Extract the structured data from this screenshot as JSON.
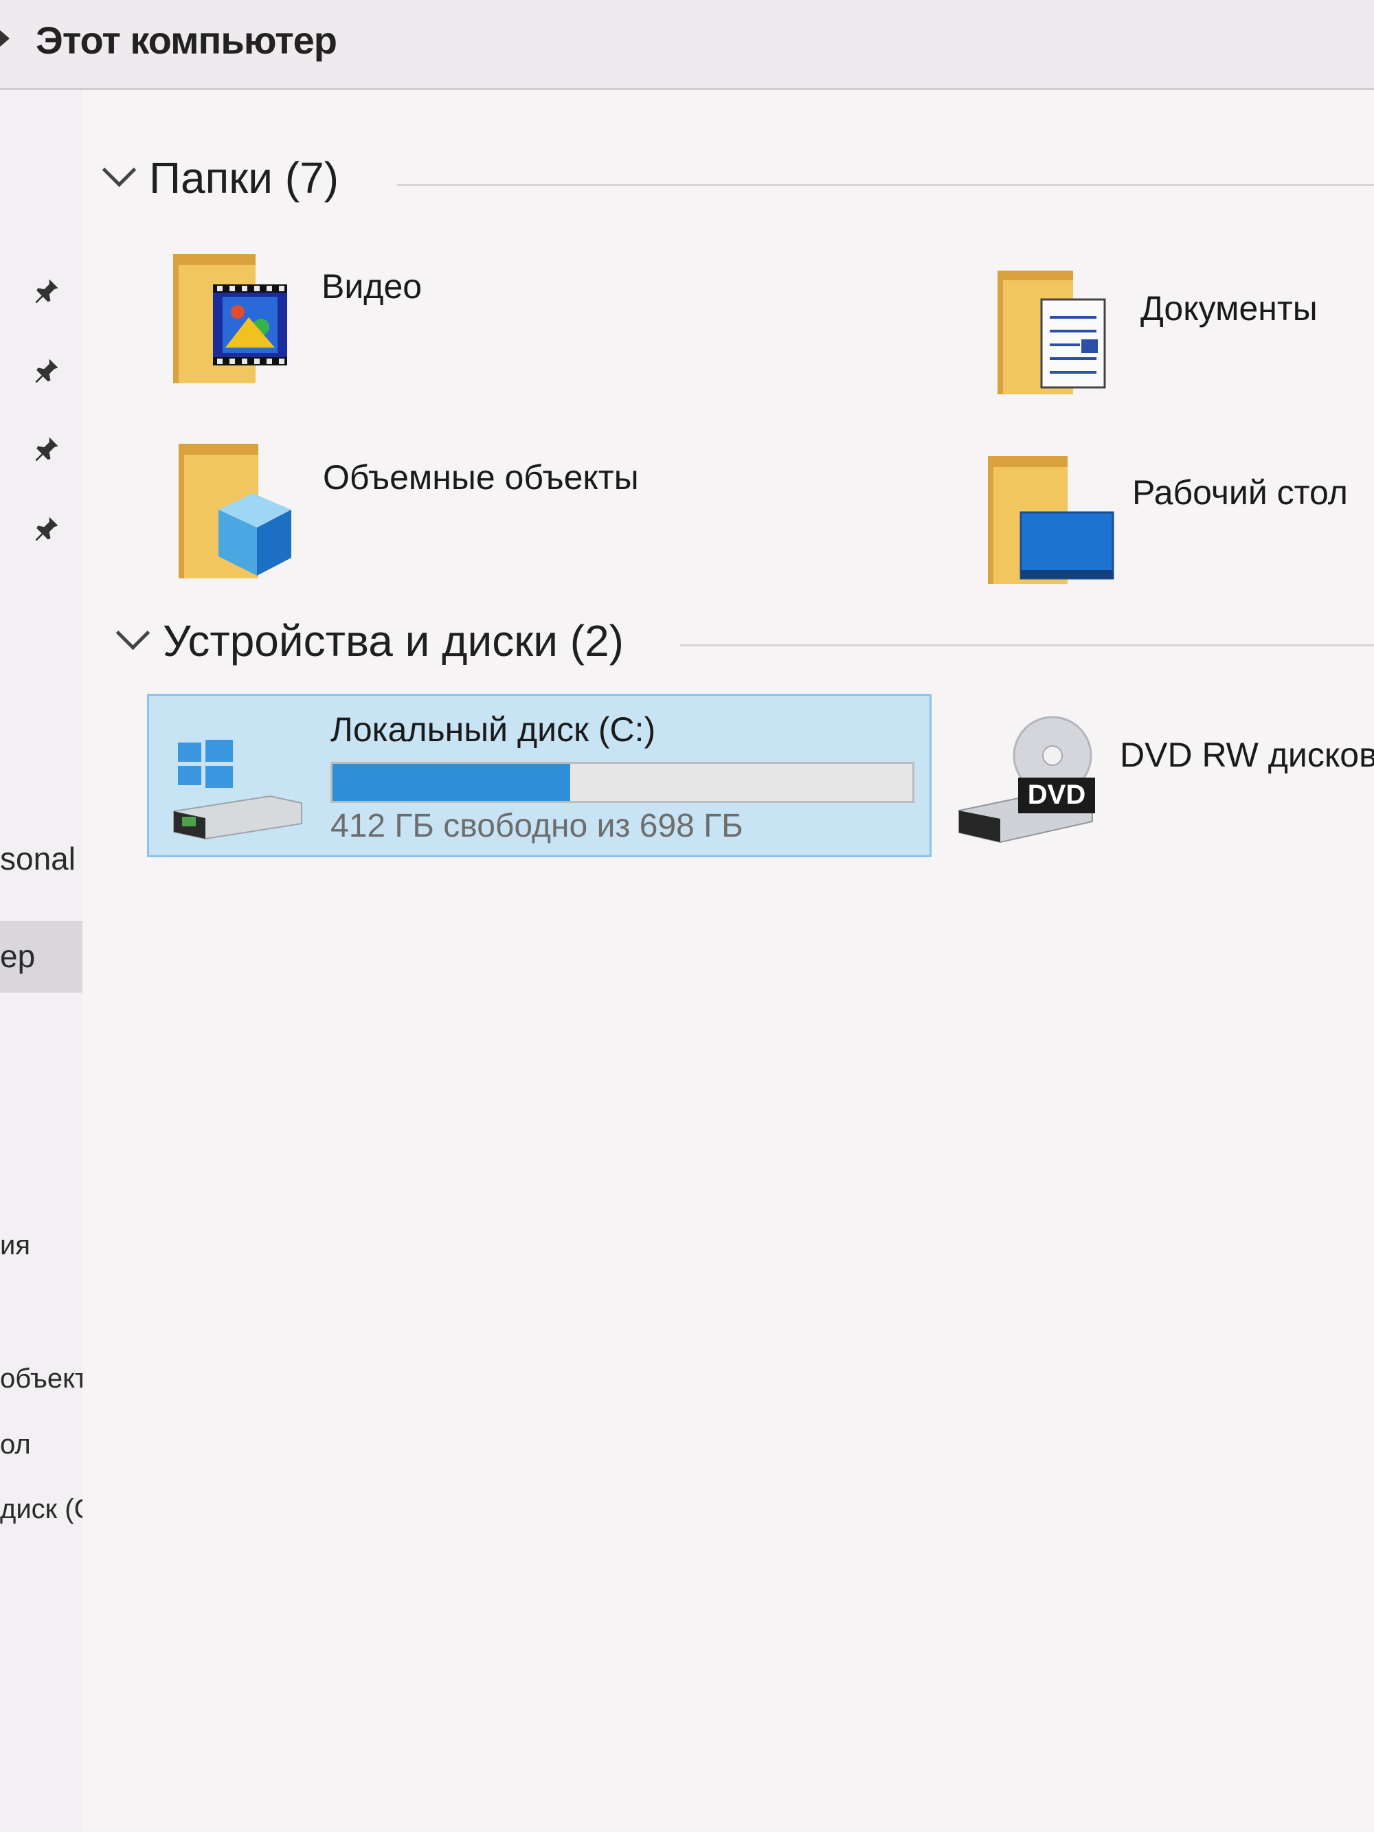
{
  "address": {
    "location": "Этот компьютер"
  },
  "nav": {
    "items": [
      "sonal",
      "ер",
      "ия",
      "объекті",
      "ол",
      "диск (С"
    ]
  },
  "folders_section": {
    "title": "Папки (7)",
    "items": [
      {
        "label": "Видео",
        "icon": "video-folder-icon"
      },
      {
        "label": "Документы",
        "icon": "documents-folder-icon"
      },
      {
        "label": "Объемные объекты",
        "icon": "3d-objects-folder-icon"
      },
      {
        "label": "Рабочий стол",
        "icon": "desktop-folder-icon"
      }
    ]
  },
  "devices_section": {
    "title": "Устройства и диски (2)",
    "drives": [
      {
        "label": "Локальный диск (C:)",
        "free_text": "412 ГБ свободно из 698 ГБ",
        "used_fraction": 0.41,
        "icon": "local-disk-icon"
      },
      {
        "label": "DVD RW дисков",
        "badge": "DVD",
        "icon": "dvd-drive-icon"
      }
    ]
  },
  "colors": {
    "selection": "#c8e3f4",
    "usage_fill": "#2f8fd6",
    "folder": "#f4cd6a"
  }
}
